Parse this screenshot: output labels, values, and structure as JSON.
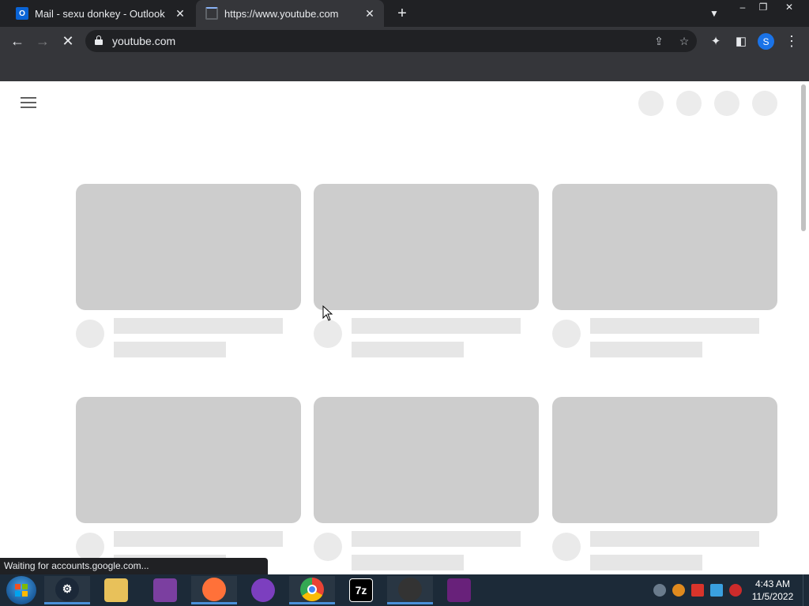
{
  "tabs": [
    {
      "title": "Mail - sexu donkey - Outlook",
      "favicon": "outlook-icon",
      "favicon_text": "O"
    },
    {
      "title": "https://www.youtube.com",
      "favicon": "loading-spinner-icon"
    }
  ],
  "window_controls": {
    "minimize": "–",
    "restore": "❐",
    "close": "✕"
  },
  "toolbar": {
    "back": "←",
    "forward": "→",
    "stop": "✕",
    "url": "youtube.com",
    "share": "⇪",
    "bookmark": "☆",
    "extensions": "✦",
    "sidepanel": "◧",
    "profile_initial": "S",
    "menu": "⋮"
  },
  "page": {
    "loading_skeleton": true
  },
  "status_text": "Waiting for accounts.google.com...",
  "taskbar": {
    "apps": [
      {
        "name": "steam",
        "label": "",
        "color": "#1b2838"
      },
      {
        "name": "file-explorer",
        "label": "",
        "color": "#e8c15a"
      },
      {
        "name": "winrar",
        "label": "",
        "color": "#7b3fa0"
      },
      {
        "name": "firefox",
        "label": "",
        "color": "#ff7139"
      },
      {
        "name": "gaming-app",
        "label": "",
        "color": "#7c3fbf"
      },
      {
        "name": "chrome",
        "label": "",
        "color": "#4285f4"
      },
      {
        "name": "7zip",
        "label": "7z",
        "color": "#000000"
      },
      {
        "name": "media-app",
        "label": "",
        "color": "#333333"
      },
      {
        "name": "visual-studio",
        "label": "",
        "color": "#68217a"
      }
    ],
    "clock_time": "4:43 AM",
    "clock_date": "11/5/2022"
  },
  "colors": {
    "chrome_dark": "#202124",
    "chrome_toolbar": "#35363a",
    "skeleton": "#cdcdcd",
    "taskbar": "#1c2a38"
  }
}
